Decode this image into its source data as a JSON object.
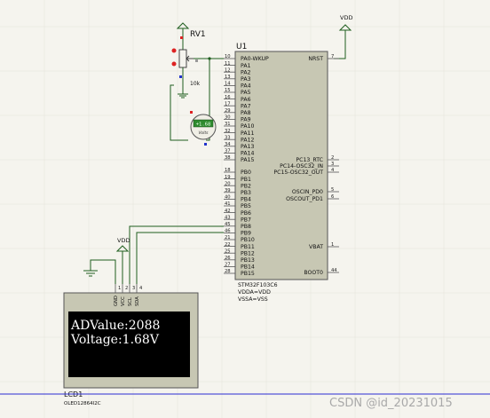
{
  "component_labels": {
    "pot_ref": "RV1",
    "pot_value": "10k",
    "mcu_ref": "U1",
    "mcu_part": "STM32F103C6",
    "mcu_power1": "VDDA=VDD",
    "mcu_power2": "VSSA=VSS",
    "lcd_ref": "LCD1",
    "lcd_part": "OLED12864I2C",
    "vdd_label": "VDD",
    "vdd_label_lcd": "VDD"
  },
  "voltmeter": {
    "reading": "+1.68",
    "unit": "Volts"
  },
  "mcu_left_pins": [
    {
      "num": "10",
      "name": "PA0-WKUP"
    },
    {
      "num": "11",
      "name": "PA1"
    },
    {
      "num": "12",
      "name": "PA2"
    },
    {
      "num": "13",
      "name": "PA3"
    },
    {
      "num": "14",
      "name": "PA4"
    },
    {
      "num": "15",
      "name": "PA5"
    },
    {
      "num": "16",
      "name": "PA6"
    },
    {
      "num": "17",
      "name": "PA7"
    },
    {
      "num": "29",
      "name": "PA8"
    },
    {
      "num": "30",
      "name": "PA9"
    },
    {
      "num": "31",
      "name": "PA10"
    },
    {
      "num": "32",
      "name": "PA11"
    },
    {
      "num": "33",
      "name": "PA12"
    },
    {
      "num": "34",
      "name": "PA13"
    },
    {
      "num": "37",
      "name": "PA14"
    },
    {
      "num": "38",
      "name": "PA15"
    },
    {
      "num": "18",
      "name": "PB0"
    },
    {
      "num": "19",
      "name": "PB1"
    },
    {
      "num": "20",
      "name": "PB2"
    },
    {
      "num": "39",
      "name": "PB3"
    },
    {
      "num": "40",
      "name": "PB4"
    },
    {
      "num": "41",
      "name": "PB5"
    },
    {
      "num": "42",
      "name": "PB6"
    },
    {
      "num": "43",
      "name": "PB7"
    },
    {
      "num": "45",
      "name": "PB8"
    },
    {
      "num": "46",
      "name": "PB9"
    },
    {
      "num": "21",
      "name": "PB10"
    },
    {
      "num": "22",
      "name": "PB11"
    },
    {
      "num": "25",
      "name": "PB12"
    },
    {
      "num": "26",
      "name": "PB13"
    },
    {
      "num": "27",
      "name": "PB14"
    },
    {
      "num": "28",
      "name": "PB15"
    }
  ],
  "mcu_right_pins": [
    {
      "num": "7",
      "name": "NRST"
    },
    {
      "num": "2",
      "name": "PC13_RTC"
    },
    {
      "num": "3",
      "name": "PC14-OSC32_IN"
    },
    {
      "num": "4",
      "name": "PC15-OSC32_OUT"
    },
    {
      "num": "5",
      "name": "OSCIN_PD0"
    },
    {
      "num": "6",
      "name": "OSCOUT_PD1"
    },
    {
      "num": "1",
      "name": "VBAT"
    },
    {
      "num": "44",
      "name": "BOOT0"
    }
  ],
  "lcd_pins": [
    {
      "num": "1",
      "name": "GND"
    },
    {
      "num": "2",
      "name": "VCC"
    },
    {
      "num": "3",
      "name": "SCL"
    },
    {
      "num": "4",
      "name": "SDA"
    }
  ],
  "oled_lines": [
    "ADValue:2088",
    "Voltage:1.68V"
  ],
  "watermark": "CSDN @id_20231015",
  "colors": {
    "wire": "#1f5e1f",
    "chip_fill": "#c7c7b3",
    "background": "#f5f4ee",
    "oled_screen": "#000000",
    "meter_display": "#2e8b2e"
  }
}
